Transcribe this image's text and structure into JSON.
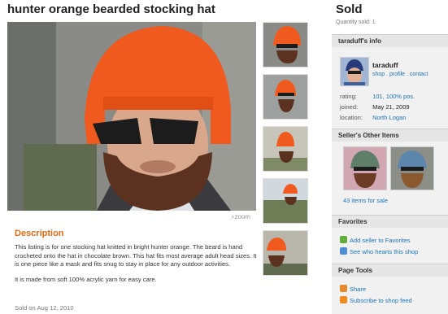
{
  "listing": {
    "title": "hunter orange bearded stocking hat",
    "zoom_label": "zoom",
    "description_heading": "Description",
    "description_p1": "This listing is for one stocking hat knitted in bright hunter orange. The beard is hand crocheted onto the hat in chocolate brown. This hat fits most average adult head sizes. It is one piece like a mask and fits snug to stay in place for any outdoor activities.",
    "description_p2": "It is made from soft 100% acrylic yarn for easy care.",
    "sold_on": "Sold on Aug 12, 2010"
  },
  "status": {
    "sold_label": "Sold",
    "quantity_sold": "Quantity sold: 1"
  },
  "seller_info": {
    "heading": "taraduff's info",
    "name": "taraduff",
    "links": "shop . profile . contact",
    "rating_label": "rating:",
    "rating_value": "101, 100% pos.",
    "joined_label": "joined:",
    "joined_value": "May 21, 2009",
    "location_label": "location:",
    "location_value": "North Logan"
  },
  "other_items": {
    "heading": "Seller's Other Items",
    "count_link": "43 items for sale"
  },
  "favorites": {
    "heading": "Favorites",
    "add_label": "Add seller to Favorites",
    "who_label": "See who hearts this shop"
  },
  "page_tools": {
    "heading": "Page Tools",
    "share_label": "Share",
    "subscribe_label": "Subscribe to shop feed"
  },
  "colors": {
    "accent_orange": "#e26b15",
    "link_blue": "#1a73b8",
    "hat_orange": "#f05a1e",
    "beard_brown": "#5b3220"
  },
  "icons": {
    "zoom": "magnifier-icon",
    "add": "plus-icon",
    "who": "people-icon",
    "share": "share-icon",
    "subscribe": "rss-icon"
  }
}
